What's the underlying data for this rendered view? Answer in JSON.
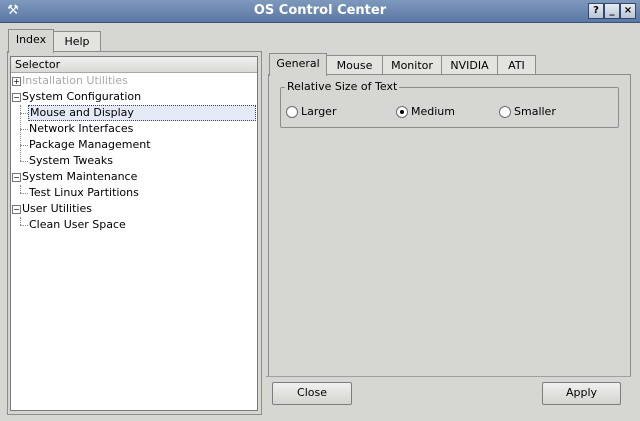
{
  "window": {
    "title": "OS Control Center",
    "app_icon": "wrench-icon",
    "help_btn": "?",
    "min_btn": "_",
    "close_btn": "×"
  },
  "left_tabs": [
    {
      "label": "Index",
      "active": true
    },
    {
      "label": "Help",
      "active": false
    }
  ],
  "tree": {
    "header": "Selector",
    "nodes": [
      {
        "label": "Installation Utilities",
        "level": 0,
        "expander": "+",
        "disabled": true
      },
      {
        "label": "System Configuration",
        "level": 0,
        "expander": "−"
      },
      {
        "label": "Mouse and Display",
        "level": 1,
        "selected": true
      },
      {
        "label": "Network Interfaces",
        "level": 1
      },
      {
        "label": "Package Management",
        "level": 1
      },
      {
        "label": "System Tweaks",
        "level": 1
      },
      {
        "label": "System Maintenance",
        "level": 0,
        "expander": "−"
      },
      {
        "label": "Test Linux Partitions",
        "level": 1
      },
      {
        "label": "User Utilities",
        "level": 0,
        "expander": "−"
      },
      {
        "label": "Clean User Space",
        "level": 1
      }
    ]
  },
  "right_tabs": [
    {
      "label": "General",
      "active": true
    },
    {
      "label": "Mouse",
      "active": false
    },
    {
      "label": "Monitor",
      "active": false
    },
    {
      "label": "NVIDIA",
      "active": false
    },
    {
      "label": "ATI",
      "active": false
    }
  ],
  "group": {
    "label": "Relative Size of Text",
    "options": [
      {
        "label": "Larger",
        "checked": false
      },
      {
        "label": "Medium",
        "checked": true
      },
      {
        "label": "Smaller",
        "checked": false
      }
    ]
  },
  "buttons": {
    "close": "Close",
    "apply": "Apply"
  }
}
